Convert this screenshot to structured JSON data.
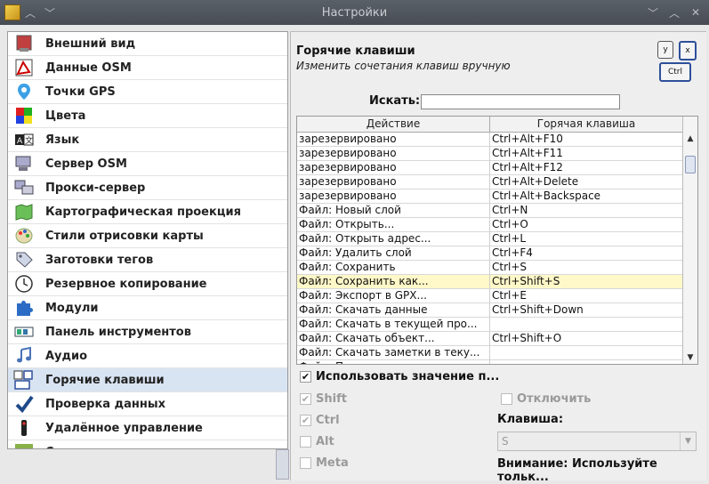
{
  "window": {
    "title": "Настройки"
  },
  "sidebar": {
    "items": [
      {
        "label": "Внешний вид",
        "icon": "appearance-icon"
      },
      {
        "label": "Данные OSM",
        "icon": "osm-data-icon"
      },
      {
        "label": "Точки GPS",
        "icon": "gps-point-icon"
      },
      {
        "label": "Цвета",
        "icon": "colors-icon"
      },
      {
        "label": "Язык",
        "icon": "language-icon"
      },
      {
        "label": "Сервер OSM",
        "icon": "server-icon"
      },
      {
        "label": "Прокси-сервер",
        "icon": "proxy-icon"
      },
      {
        "label": "Картографическая проекция",
        "icon": "map-projection-icon"
      },
      {
        "label": "Стили отрисовки карты",
        "icon": "palette-icon"
      },
      {
        "label": "Заготовки тегов",
        "icon": "tag-icon"
      },
      {
        "label": "Резервное копирование",
        "icon": "clock-icon"
      },
      {
        "label": "Модули",
        "icon": "puzzle-icon"
      },
      {
        "label": "Панель инструментов",
        "icon": "toolbar-icon"
      },
      {
        "label": "Аудио",
        "icon": "music-note-icon"
      },
      {
        "label": "Горячие клавиши",
        "icon": "keyboard-icon"
      },
      {
        "label": "Проверка данных",
        "icon": "checkmark-icon"
      },
      {
        "label": "Удалённое управление",
        "icon": "remote-icon"
      },
      {
        "label": "Сеть",
        "icon": "grid-icon"
      }
    ],
    "active_index": 14
  },
  "panel": {
    "title": "Горячие клавиши",
    "subtitle": "Изменить сочетания клавиш вручную",
    "keys_art": [
      "y",
      "x",
      "Ctrl"
    ],
    "search_label": "Искать:",
    "search_value": ""
  },
  "table": {
    "columns": [
      "Действие",
      "Горячая клавиша"
    ],
    "rows": [
      [
        "зарезервировано",
        "Ctrl+Alt+F10"
      ],
      [
        "зарезервировано",
        "Ctrl+Alt+F11"
      ],
      [
        "зарезервировано",
        "Ctrl+Alt+F12"
      ],
      [
        "зарезервировано",
        "Ctrl+Alt+Delete"
      ],
      [
        "зарезервировано",
        "Ctrl+Alt+Backspace"
      ],
      [
        "Файл: Новый слой",
        "Ctrl+N"
      ],
      [
        "Файл: Открыть...",
        "Ctrl+O"
      ],
      [
        "Файл: Открыть адрес...",
        "Ctrl+L"
      ],
      [
        "Файл: Удалить слой",
        "Ctrl+F4"
      ],
      [
        "Файл: Сохранить",
        "Ctrl+S"
      ],
      [
        "Файл: Сохранить как...",
        "Ctrl+Shift+S"
      ],
      [
        "Файл: Экспорт в GPX...",
        "Ctrl+E"
      ],
      [
        "Файл: Скачать данные",
        "Ctrl+Shift+Down"
      ],
      [
        "Файл: Скачать в текущей про...",
        ""
      ],
      [
        "Файл: Скачать объект...",
        "Ctrl+Shift+O"
      ],
      [
        "Файл: Скачать заметки в теку...",
        ""
      ],
      [
        "Файл: П...",
        ""
      ]
    ],
    "selected_index": 10
  },
  "options": {
    "use_value_label": "Использовать значение п...",
    "use_value_checked": true,
    "shift_label": "Shift",
    "shift_checked": true,
    "ctrl_label": "Ctrl",
    "ctrl_checked": true,
    "alt_label": "Alt",
    "alt_checked": false,
    "meta_label": "Meta",
    "meta_checked": false,
    "disable_label": "Отключить",
    "disable_checked": false,
    "key_label": "Клавиша:",
    "key_value": "S",
    "warning": "Внимание: Используйте тольк..."
  },
  "colors": {
    "active_item_bg": "#d9e4f2",
    "selected_row_bg": "#fff8c8",
    "titlebar_bg": "#4f555d"
  }
}
